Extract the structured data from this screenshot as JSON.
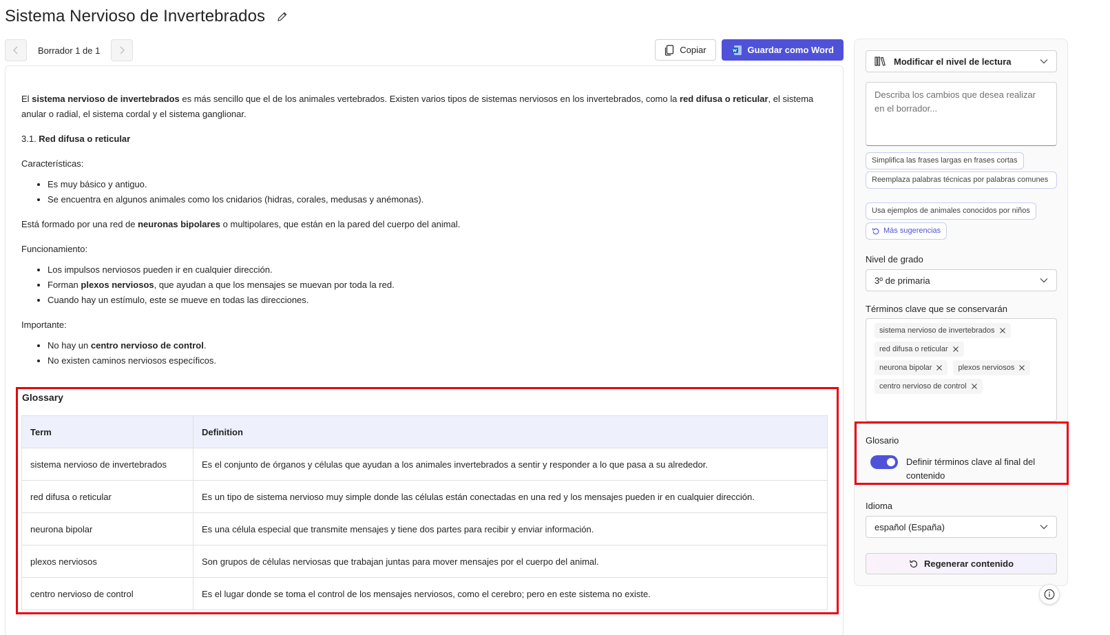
{
  "header": {
    "title": "Sistema Nervioso de Invertebrados",
    "edit_icon": "pencil-icon"
  },
  "draft_nav": {
    "label": "Borrador 1 de 1",
    "prev_icon": "chevron-left-icon",
    "next_icon": "chevron-right-icon"
  },
  "actions": {
    "copy_label": "Copiar",
    "save_word_label": "Guardar como Word"
  },
  "content": {
    "intro": {
      "t1": "El ",
      "b1": "sistema nervioso de invertebrados",
      "t2": " es más sencillo que el de los animales vertebrados. Existen varios tipos de sistemas nerviosos en los invertebrados, como la ",
      "b2": "red difusa o reticular",
      "t3": ", el sistema anular o radial, el sistema cordal y el sistema ganglionar."
    },
    "section": {
      "number": "3.1. ",
      "title": "Red difusa o reticular"
    },
    "characteristics_label": "Características:",
    "characteristics": [
      "Es muy básico y antiguo.",
      "Se encuentra en algunos animales como los cnidarios (hidras, corales, medusas y anémonas)."
    ],
    "formed": {
      "t1": "Está formado por una red de ",
      "b1": "neuronas bipolares",
      "t2": " o multipolares, que están en la pared del cuerpo del animal."
    },
    "functioning_label": "Funcionamiento:",
    "functioning": {
      "item1": "Los impulsos nerviosos pueden ir en cualquier dirección.",
      "item2_t1": "Forman ",
      "item2_b1": "plexos nerviosos",
      "item2_t2": ", que ayudan a que los mensajes se muevan por toda la red.",
      "item3": "Cuando hay un estímulo, este se mueve en todas las direcciones."
    },
    "important_label": "Importante:",
    "important": {
      "item1_t1": "No hay un ",
      "item1_b1": "centro nervioso de control",
      "item1_t2": ".",
      "item2": "No existen caminos nerviosos específicos."
    }
  },
  "glossary": {
    "title": "Glossary",
    "col_term": "Term",
    "col_definition": "Definition",
    "rows": [
      {
        "term": "sistema nervioso de invertebrados",
        "definition": "Es el conjunto de órganos y células que ayudan a los animales invertebrados a sentir y responder a lo que pasa a su alrededor."
      },
      {
        "term": "red difusa o reticular",
        "definition": "Es un tipo de sistema nervioso muy simple donde las células están conectadas en una red y los mensajes pueden ir en cualquier dirección."
      },
      {
        "term": "neurona bipolar",
        "definition": "Es una célula especial que transmite mensajes y tiene dos partes para recibir y enviar información."
      },
      {
        "term": "plexos nerviosos",
        "definition": "Son grupos de células nerviosas que trabajan juntas para mover mensajes por el cuerpo del animal."
      },
      {
        "term": "centro nervioso de control",
        "definition": "Es el lugar donde se toma el control de los mensajes nerviosos, como el cerebro; pero en este sistema no existe."
      }
    ]
  },
  "sidebar": {
    "reading_level_label": "Modificar el nivel de lectura",
    "prompt_placeholder": "Describa los cambios que desea realizar en el borrador...",
    "suggestions": [
      "Simplifica las frases largas en frases cortas",
      "Reemplaza palabras técnicas por palabras comunes",
      "Usa ejemplos de animales conocidos por niños"
    ],
    "more_suggestions": "Más sugerencias",
    "grade_label": "Nivel de grado",
    "grade_value": "3º de primaria",
    "terms_label": "Términos clave que se conservarán",
    "terms": [
      "sistema nervioso de invertebrados",
      "red difusa o reticular",
      "neurona bipolar",
      "plexos nerviosos",
      "centro nervioso de control"
    ],
    "glossary_label": "Glosario",
    "glossary_toggle_text": "Definir términos clave al final del contenido",
    "glossary_toggle_on": true,
    "language_label": "Idioma",
    "language_value": "español (España)",
    "regenerate_label": "Regenerar contenido"
  },
  "colors": {
    "accent": "#4f52d9",
    "highlight_border": "#e8000d",
    "table_header_bg": "#eef0fb"
  }
}
